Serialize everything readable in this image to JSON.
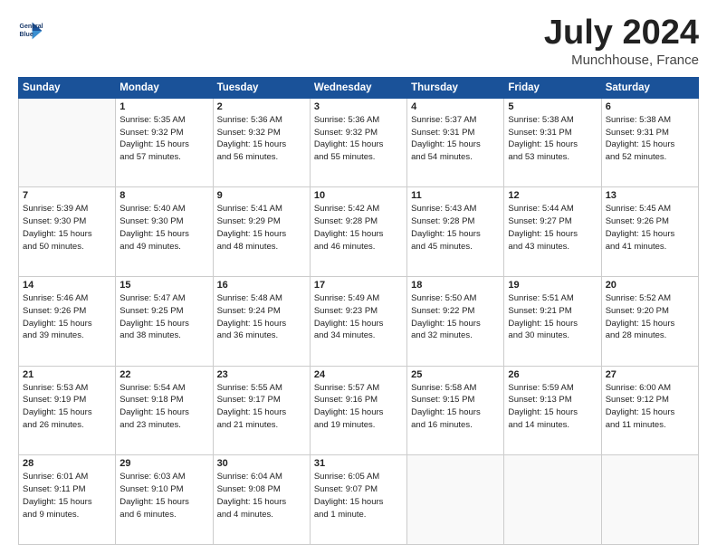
{
  "header": {
    "logo_line1": "General",
    "logo_line2": "Blue",
    "title": "July 2024",
    "location": "Munchhouse, France"
  },
  "weekdays": [
    "Sunday",
    "Monday",
    "Tuesday",
    "Wednesday",
    "Thursday",
    "Friday",
    "Saturday"
  ],
  "weeks": [
    [
      {
        "day": "",
        "lines": []
      },
      {
        "day": "1",
        "lines": [
          "Sunrise: 5:35 AM",
          "Sunset: 9:32 PM",
          "Daylight: 15 hours",
          "and 57 minutes."
        ]
      },
      {
        "day": "2",
        "lines": [
          "Sunrise: 5:36 AM",
          "Sunset: 9:32 PM",
          "Daylight: 15 hours",
          "and 56 minutes."
        ]
      },
      {
        "day": "3",
        "lines": [
          "Sunrise: 5:36 AM",
          "Sunset: 9:32 PM",
          "Daylight: 15 hours",
          "and 55 minutes."
        ]
      },
      {
        "day": "4",
        "lines": [
          "Sunrise: 5:37 AM",
          "Sunset: 9:31 PM",
          "Daylight: 15 hours",
          "and 54 minutes."
        ]
      },
      {
        "day": "5",
        "lines": [
          "Sunrise: 5:38 AM",
          "Sunset: 9:31 PM",
          "Daylight: 15 hours",
          "and 53 minutes."
        ]
      },
      {
        "day": "6",
        "lines": [
          "Sunrise: 5:38 AM",
          "Sunset: 9:31 PM",
          "Daylight: 15 hours",
          "and 52 minutes."
        ]
      }
    ],
    [
      {
        "day": "7",
        "lines": [
          "Sunrise: 5:39 AM",
          "Sunset: 9:30 PM",
          "Daylight: 15 hours",
          "and 50 minutes."
        ]
      },
      {
        "day": "8",
        "lines": [
          "Sunrise: 5:40 AM",
          "Sunset: 9:30 PM",
          "Daylight: 15 hours",
          "and 49 minutes."
        ]
      },
      {
        "day": "9",
        "lines": [
          "Sunrise: 5:41 AM",
          "Sunset: 9:29 PM",
          "Daylight: 15 hours",
          "and 48 minutes."
        ]
      },
      {
        "day": "10",
        "lines": [
          "Sunrise: 5:42 AM",
          "Sunset: 9:28 PM",
          "Daylight: 15 hours",
          "and 46 minutes."
        ]
      },
      {
        "day": "11",
        "lines": [
          "Sunrise: 5:43 AM",
          "Sunset: 9:28 PM",
          "Daylight: 15 hours",
          "and 45 minutes."
        ]
      },
      {
        "day": "12",
        "lines": [
          "Sunrise: 5:44 AM",
          "Sunset: 9:27 PM",
          "Daylight: 15 hours",
          "and 43 minutes."
        ]
      },
      {
        "day": "13",
        "lines": [
          "Sunrise: 5:45 AM",
          "Sunset: 9:26 PM",
          "Daylight: 15 hours",
          "and 41 minutes."
        ]
      }
    ],
    [
      {
        "day": "14",
        "lines": [
          "Sunrise: 5:46 AM",
          "Sunset: 9:26 PM",
          "Daylight: 15 hours",
          "and 39 minutes."
        ]
      },
      {
        "day": "15",
        "lines": [
          "Sunrise: 5:47 AM",
          "Sunset: 9:25 PM",
          "Daylight: 15 hours",
          "and 38 minutes."
        ]
      },
      {
        "day": "16",
        "lines": [
          "Sunrise: 5:48 AM",
          "Sunset: 9:24 PM",
          "Daylight: 15 hours",
          "and 36 minutes."
        ]
      },
      {
        "day": "17",
        "lines": [
          "Sunrise: 5:49 AM",
          "Sunset: 9:23 PM",
          "Daylight: 15 hours",
          "and 34 minutes."
        ]
      },
      {
        "day": "18",
        "lines": [
          "Sunrise: 5:50 AM",
          "Sunset: 9:22 PM",
          "Daylight: 15 hours",
          "and 32 minutes."
        ]
      },
      {
        "day": "19",
        "lines": [
          "Sunrise: 5:51 AM",
          "Sunset: 9:21 PM",
          "Daylight: 15 hours",
          "and 30 minutes."
        ]
      },
      {
        "day": "20",
        "lines": [
          "Sunrise: 5:52 AM",
          "Sunset: 9:20 PM",
          "Daylight: 15 hours",
          "and 28 minutes."
        ]
      }
    ],
    [
      {
        "day": "21",
        "lines": [
          "Sunrise: 5:53 AM",
          "Sunset: 9:19 PM",
          "Daylight: 15 hours",
          "and 26 minutes."
        ]
      },
      {
        "day": "22",
        "lines": [
          "Sunrise: 5:54 AM",
          "Sunset: 9:18 PM",
          "Daylight: 15 hours",
          "and 23 minutes."
        ]
      },
      {
        "day": "23",
        "lines": [
          "Sunrise: 5:55 AM",
          "Sunset: 9:17 PM",
          "Daylight: 15 hours",
          "and 21 minutes."
        ]
      },
      {
        "day": "24",
        "lines": [
          "Sunrise: 5:57 AM",
          "Sunset: 9:16 PM",
          "Daylight: 15 hours",
          "and 19 minutes."
        ]
      },
      {
        "day": "25",
        "lines": [
          "Sunrise: 5:58 AM",
          "Sunset: 9:15 PM",
          "Daylight: 15 hours",
          "and 16 minutes."
        ]
      },
      {
        "day": "26",
        "lines": [
          "Sunrise: 5:59 AM",
          "Sunset: 9:13 PM",
          "Daylight: 15 hours",
          "and 14 minutes."
        ]
      },
      {
        "day": "27",
        "lines": [
          "Sunrise: 6:00 AM",
          "Sunset: 9:12 PM",
          "Daylight: 15 hours",
          "and 11 minutes."
        ]
      }
    ],
    [
      {
        "day": "28",
        "lines": [
          "Sunrise: 6:01 AM",
          "Sunset: 9:11 PM",
          "Daylight: 15 hours",
          "and 9 minutes."
        ]
      },
      {
        "day": "29",
        "lines": [
          "Sunrise: 6:03 AM",
          "Sunset: 9:10 PM",
          "Daylight: 15 hours",
          "and 6 minutes."
        ]
      },
      {
        "day": "30",
        "lines": [
          "Sunrise: 6:04 AM",
          "Sunset: 9:08 PM",
          "Daylight: 15 hours",
          "and 4 minutes."
        ]
      },
      {
        "day": "31",
        "lines": [
          "Sunrise: 6:05 AM",
          "Sunset: 9:07 PM",
          "Daylight: 15 hours",
          "and 1 minute."
        ]
      },
      {
        "day": "",
        "lines": []
      },
      {
        "day": "",
        "lines": []
      },
      {
        "day": "",
        "lines": []
      }
    ]
  ]
}
